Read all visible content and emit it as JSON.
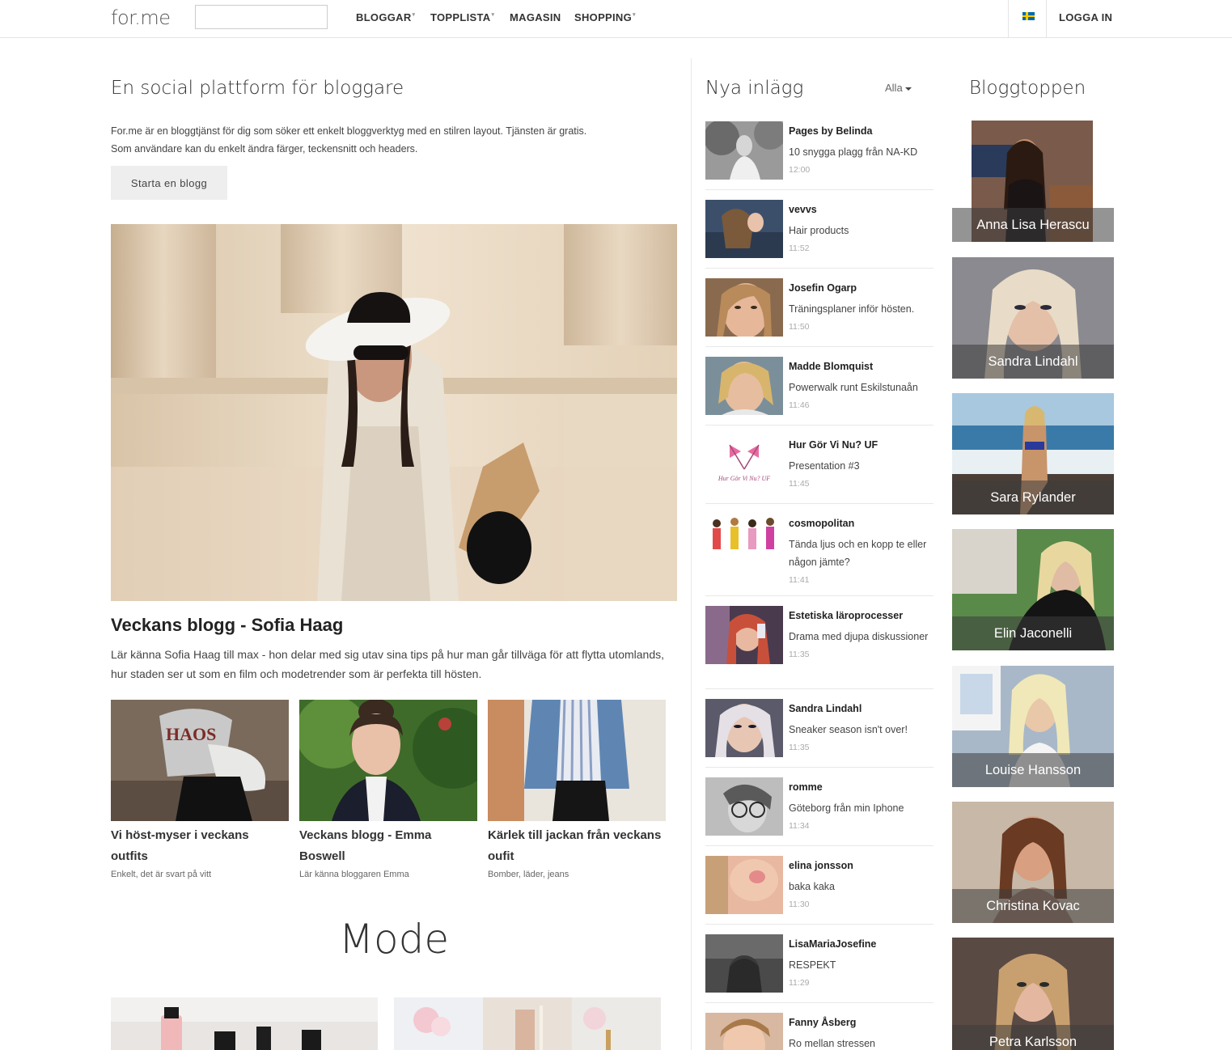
{
  "nav": {
    "logo": "for.me",
    "items": [
      {
        "label": "BLOGGAR",
        "caret": true
      },
      {
        "label": "TOPPLISTA",
        "caret": true
      },
      {
        "label": "MAGASIN",
        "caret": false
      },
      {
        "label": "SHOPPING",
        "caret": true
      }
    ],
    "login": "LOGGA IN"
  },
  "intro": {
    "title": "En social plattform för bloggare",
    "text_line1": "For.me är en bloggtjänst för dig som söker ett enkelt bloggverktyg med en stilren layout. Tjänsten är gratis.",
    "text_line2": "Som användare kan du enkelt ändra färger, teckensnitt och headers.",
    "button": "Starta en blogg"
  },
  "featured": {
    "title": "Veckans blogg - Sofia Haag",
    "text": "Lär känna Sofia Haag till max - hon delar med sig utav sina tips på hur man går tillväga för att flytta utomlands, hur staden ser ut som en film och modetrender som är perfekta till hösten."
  },
  "cards": [
    {
      "title": "Vi höst-myser i veckans outfits",
      "sub": "Enkelt, det är svart på vitt"
    },
    {
      "title": "Veckans blogg - Emma Boswell",
      "sub": "Lär känna bloggaren Emma"
    },
    {
      "title": "Kärlek till jackan från veckans oufit",
      "sub": "Bomber, läder, jeans"
    }
  ],
  "section": {
    "title": "Mode"
  },
  "posts_header": {
    "title": "Nya inlägg",
    "filter": "Alla"
  },
  "posts": [
    {
      "author": "Pages by Belinda",
      "title": "10 snygga plagg från NA-KD",
      "time": "12:00"
    },
    {
      "author": "vevvs",
      "title": "Hair products",
      "time": "11:52"
    },
    {
      "author": "Josefin Ogarp",
      "title": "Träningsplaner inför hösten.",
      "time": "11:50"
    },
    {
      "author": "Madde Blomquist",
      "title": "Powerwalk runt Eskilstunaån",
      "time": "11:46"
    },
    {
      "author": "Hur Gör Vi Nu? UF",
      "title": "Presentation #3",
      "time": "11:45"
    },
    {
      "author": "cosmopolitan",
      "title": "Tända ljus och en kopp te eller någon jämte?",
      "time": "11:41"
    },
    {
      "author": "Estetiska läroprocesser",
      "title": "Drama med djupa diskussioner",
      "time": "11:35"
    },
    {
      "author": "Sandra Lindahl",
      "title": "Sneaker season isn't over!",
      "time": "11:35"
    },
    {
      "author": "romme",
      "title": "Göteborg från min Iphone",
      "time": "11:34"
    },
    {
      "author": "elina jonsson",
      "title": "baka kaka",
      "time": "11:30"
    },
    {
      "author": "LisaMariaJosefine",
      "title": "RESPEKT",
      "time": "11:29"
    },
    {
      "author": "Fanny Åsberg",
      "title": "Ro mellan stressen",
      "time": ""
    }
  ],
  "toplist": {
    "title": "Bloggtoppen",
    "bloggers": [
      {
        "name": "Anna Lisa Herascu"
      },
      {
        "name": "Sandra Lindahl"
      },
      {
        "name": "Sara Rylander"
      },
      {
        "name": "Elin Jaconelli"
      },
      {
        "name": "Louise Hansson"
      },
      {
        "name": "Christina Kovac"
      },
      {
        "name": "Petra Karlsson"
      }
    ]
  }
}
